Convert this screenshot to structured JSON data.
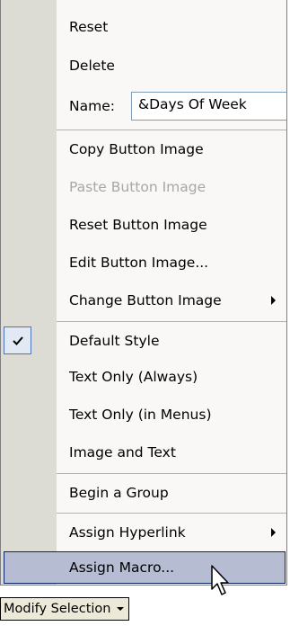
{
  "menu": {
    "reset": "Reset",
    "delete": "Delete",
    "name_label": "Name:",
    "name_value": "&Days Of Week",
    "copy_image": "Copy Button Image",
    "paste_image": "Paste Button Image",
    "reset_image": "Reset Button Image",
    "edit_image": "Edit Button Image...",
    "change_image": "Change Button Image",
    "default_style": "Default Style",
    "text_only_always": "Text Only (Always)",
    "text_only_menus": "Text Only (in Menus)",
    "image_and_text": "Image and Text",
    "begin_group": "Begin a Group",
    "assign_hyperlink": "Assign Hyperlink",
    "assign_macro": "Assign Macro..."
  },
  "modify_selection": "Modify Selection",
  "colors": {
    "gutter": "#dcdcd4",
    "highlight": "#b6bdd2",
    "highlight_border": "#0a246a",
    "check_bg": "#e3e9f4"
  },
  "icons": {
    "check": "check-icon",
    "submenu": "submenu-arrow-icon",
    "dropdown": "dropdown-arrow-icon",
    "cursor": "mouse-pointer-icon"
  }
}
